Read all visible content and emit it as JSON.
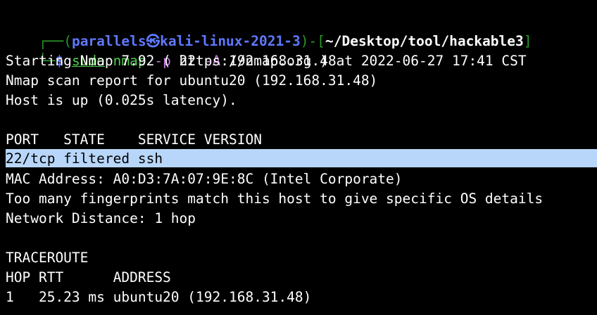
{
  "colors": {
    "background": "#000000",
    "prompt_frame": "#2a9a2a",
    "prompt_user": "#5f79ff",
    "command": "#4dd04d",
    "option": "#c678dd",
    "highlight": "#b8d6f9"
  },
  "prompt": {
    "corner_top": "┌──",
    "open_paren": "(",
    "user": "parallels",
    "at_symbol": "㉿",
    "host": "kali-linux-2021-3",
    "close_paren": ")",
    "dash": "-",
    "open_bracket": "[",
    "path": "~/Desktop/tool/hackable3",
    "close_bracket": "]",
    "corner_bottom": "└─",
    "dollar": "$"
  },
  "command": {
    "sudo": "sudo",
    "program": "nmap",
    "opt_p": "-p",
    "port": "22",
    "opt_a": "-A",
    "target": "192.168.31.48"
  },
  "output": {
    "starting": "Starting Nmap 7.92 ( https://nmap.org ) at 2022-06-27 17:41 CST",
    "report": "Nmap scan report for ubuntu20 (192.168.31.48)",
    "host_up": "Host is up (0.025s latency).",
    "port_header": "PORT   STATE    SERVICE VERSION",
    "port_row": "22/tcp filtered ssh",
    "mac": "MAC Address: A0:D3:7A:07:9E:8C (Intel Corporate)",
    "fingerprints": "Too many fingerprints match this host to give specific OS details",
    "distance": "Network Distance: 1 hop",
    "traceroute_title": "TRACEROUTE",
    "trace_header": "HOP RTT      ADDRESS",
    "trace_row": "1   25.23 ms ubuntu20 (192.168.31.48)"
  }
}
